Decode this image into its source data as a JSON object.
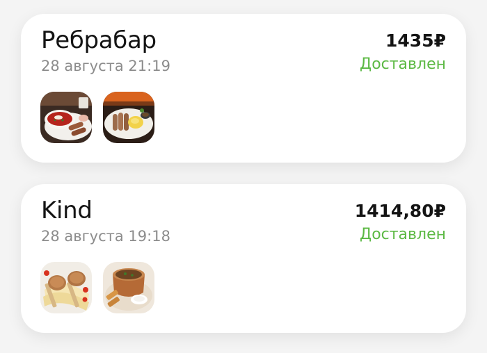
{
  "orders": [
    {
      "restaurant": "Ребрабар",
      "date": "28 августа 21:19",
      "price": "1435₽",
      "status": "Доставлен",
      "items": [
        "borscht-dish-image",
        "sausages-mashed-potatoes-image"
      ]
    },
    {
      "restaurant": "Kind",
      "date": "28 августа 19:18",
      "price": "1414,80₽",
      "status": "Доставлен",
      "items": [
        "cutlets-dish-image",
        "soup-pot-dish-image"
      ]
    }
  ],
  "colors": {
    "status_delivered": "#5cb944",
    "text_primary": "#141414",
    "text_secondary": "#8c8c8c",
    "card_background": "#ffffff",
    "page_background": "#f4f4f4"
  }
}
